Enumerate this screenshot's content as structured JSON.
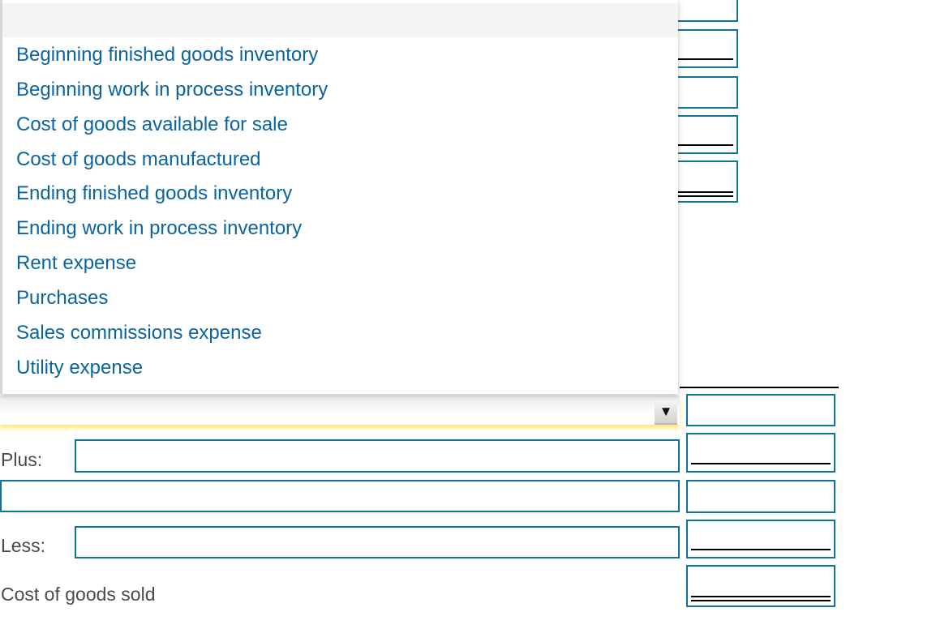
{
  "dropdown": {
    "selected": "",
    "options": [
      "Beginning finished goods inventory",
      "Beginning work in process inventory",
      "Cost of goods available for sale",
      "Cost of goods manufactured",
      "Ending finished goods inventory",
      "Ending work in process inventory",
      "Rent expense",
      "Purchases",
      "Sales commissions expense",
      "Utility expense"
    ],
    "arrow_icon": "▼"
  },
  "form": {
    "plus_label": "Plus:",
    "less_label": "Less:",
    "cogs_label": "Cost of goods sold",
    "plus_input": "",
    "row2_input": "",
    "less_input": "",
    "amounts": [
      "",
      "",
      "",
      "",
      ""
    ],
    "top_amounts": [
      "",
      "",
      "",
      "",
      ""
    ]
  },
  "colors": {
    "accent_border": "#0e7598",
    "option_text": "#0a64a0",
    "focus_glow": "#ffdc28"
  }
}
